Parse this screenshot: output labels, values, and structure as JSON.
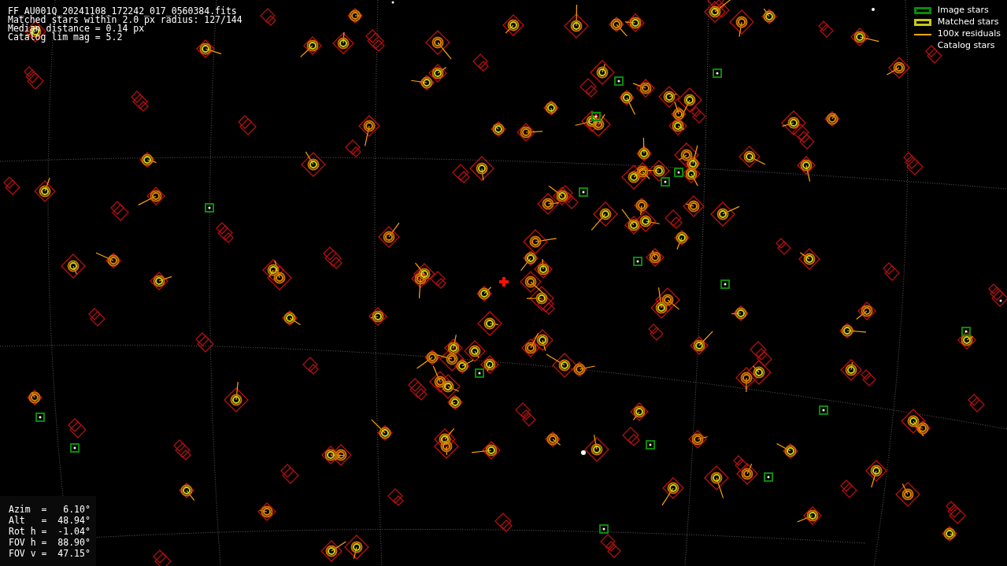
{
  "header": {
    "lines": [
      "FF_AU001Q_20241108_172242_017_0560384.fits",
      "Matched stars within 2.0 px radius: 127/144",
      "Median distance = 0.14 px",
      "Catalog lim mag = 5.2"
    ]
  },
  "legend": [
    {
      "kind": "image",
      "label": "Image stars"
    },
    {
      "kind": "matched",
      "label": "Matched stars"
    },
    {
      "kind": "residual",
      "label": "100x residuals"
    },
    {
      "kind": "catalog",
      "label": "Catalog stars"
    }
  ],
  "pointing": {
    "lines": [
      "Azim  =   6.10°",
      "Alt   =  48.94°",
      "Rot h =  -1.04°",
      "FOV h =  88.90°",
      "FOV v =  47.15°"
    ]
  }
}
